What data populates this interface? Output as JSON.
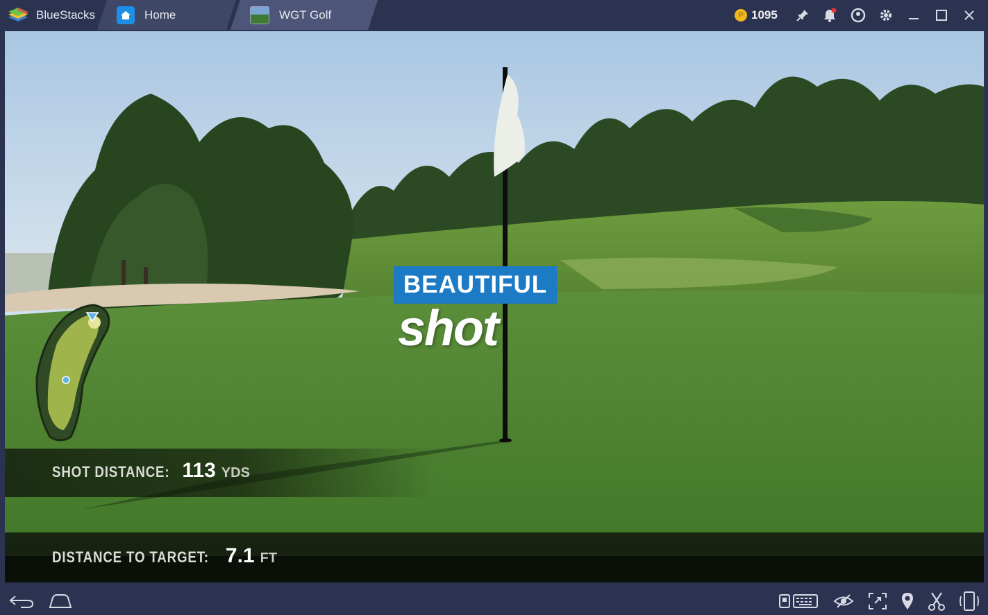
{
  "titlebar": {
    "brand": "BlueStacks",
    "tabs": [
      {
        "label": "Home",
        "icon": "home-icon"
      },
      {
        "label": "WGT Golf",
        "icon": "wgt-golf-app-icon"
      }
    ],
    "coins": "1095",
    "buttons": [
      "pin-icon",
      "bell-icon",
      "account-icon",
      "gear-icon",
      "minimize-icon",
      "maximize-icon",
      "close-icon"
    ]
  },
  "game": {
    "banner_top": "BEAUTIFUL",
    "banner_bottom": "shot",
    "shot_distance": {
      "label": "SHOT DISTANCE:",
      "value": "113",
      "unit": "YDS"
    },
    "distance_to_target": {
      "label": "DISTANCE TO TARGET:",
      "value": "7.1",
      "unit": "FT"
    }
  },
  "navbar": {
    "buttons": [
      "back-icon",
      "home-icon",
      "keyboard-icon",
      "eye-icon",
      "fullscreen-icon",
      "location-icon",
      "scissors-icon",
      "rotate-phone-icon"
    ]
  },
  "colors": {
    "chrome": "#2c3351",
    "banner": "#1d7ac5",
    "coin": "#f3b71e",
    "notification": "#e53935"
  }
}
